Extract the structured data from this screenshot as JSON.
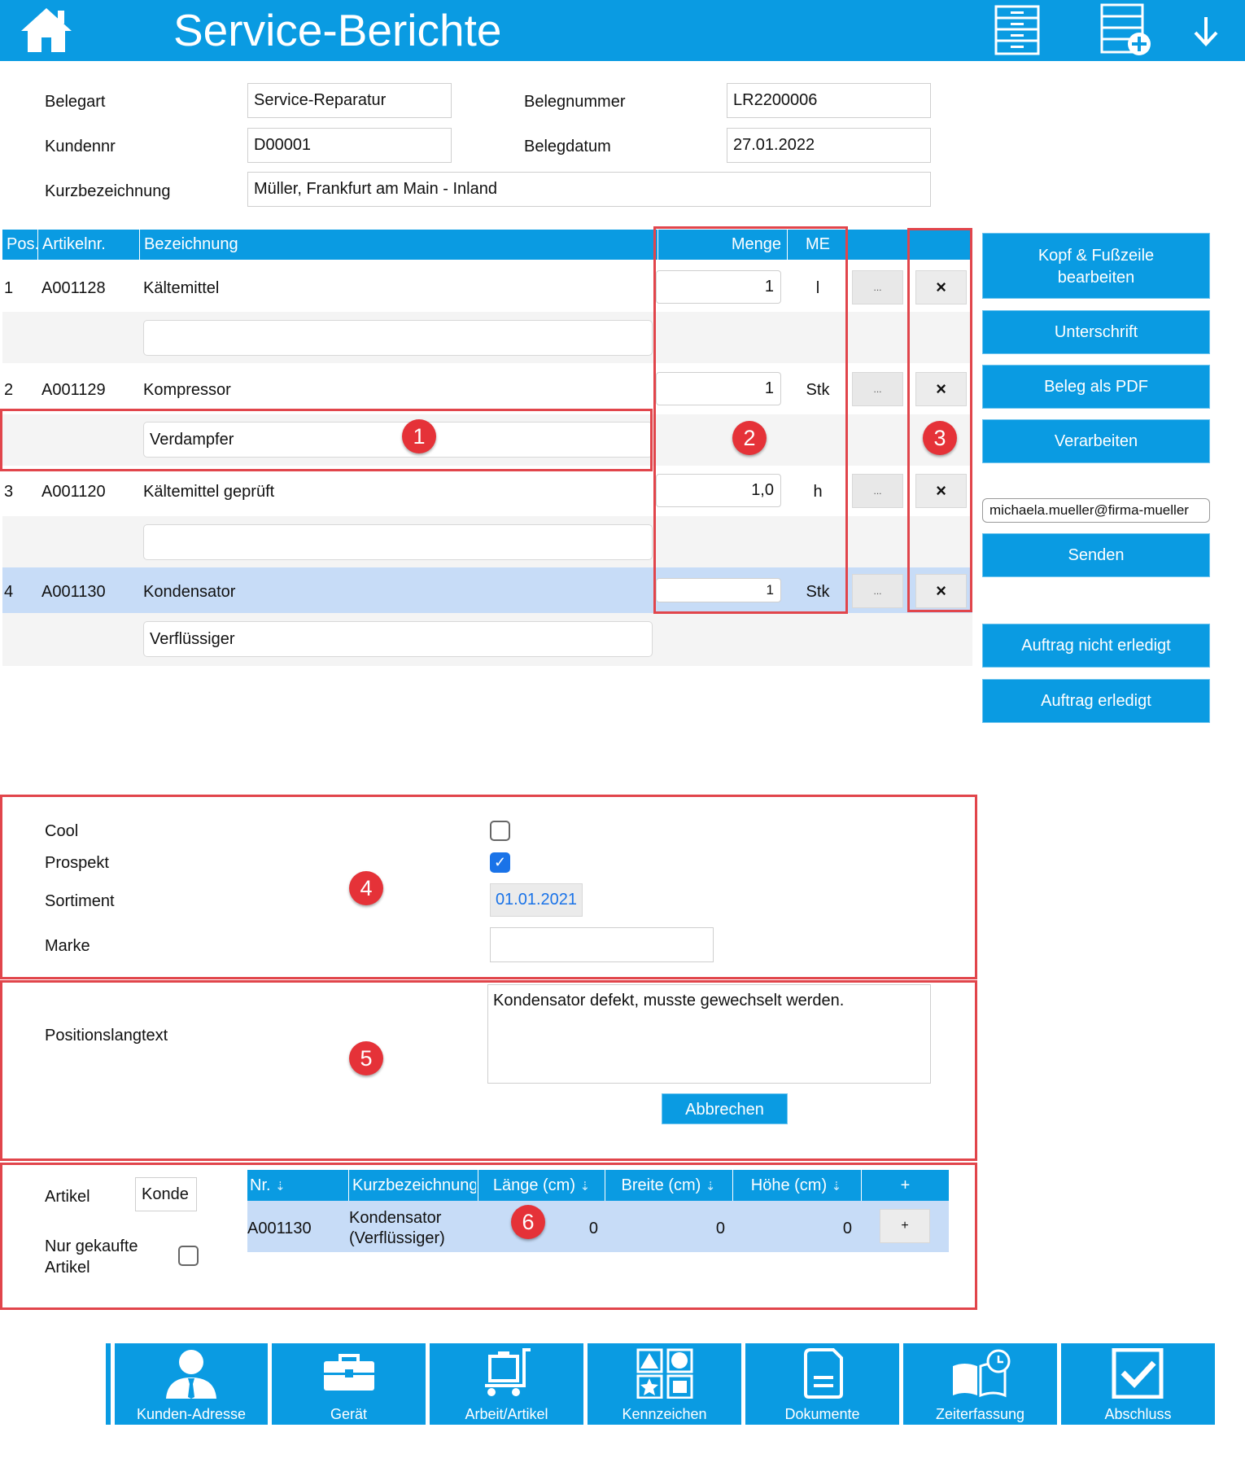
{
  "header": {
    "title": "Service-Berichte",
    "icons": [
      "home-icon",
      "list-icon",
      "list-add-icon",
      "arrow-down-icon"
    ]
  },
  "form": {
    "belegart_label": "Belegart",
    "belegart_value": "Service-Reparatur",
    "belegnummer_label": "Belegnummer",
    "belegnummer_value": "LR2200006",
    "kundennr_label": "Kundennr",
    "kundennr_value": "D00001",
    "belegdatum_label": "Belegdatum",
    "belegdatum_value": "27.01.2022",
    "kurzbezeichnung_label": "Kurzbezeichnung",
    "kurzbezeichnung_value": "Müller, Frankfurt am Main - Inland"
  },
  "positions": {
    "headers": {
      "pos": "Pos.",
      "artikelnr": "Artikelnr.",
      "bezeichnung": "Bezeichnung",
      "menge": "Menge",
      "me": "ME"
    },
    "rows": [
      {
        "pos": "1",
        "artikelnr": "A001128",
        "bezeichnung": "Kältemittel",
        "menge": "1",
        "me": "l",
        "sub": "",
        "more": "...",
        "delete": "×"
      },
      {
        "pos": "2",
        "artikelnr": "A001129",
        "bezeichnung": "Kompressor",
        "menge": "1",
        "me": "Stk",
        "sub": "Verdampfer",
        "more": "...",
        "delete": "×"
      },
      {
        "pos": "3",
        "artikelnr": "A001120",
        "bezeichnung": "Kältemittel geprüft",
        "menge": "1,0",
        "me": "h",
        "sub": "",
        "more": "...",
        "delete": "×"
      },
      {
        "pos": "4",
        "artikelnr": "A001130",
        "bezeichnung": "Kondensator",
        "menge": "1",
        "me": "Stk",
        "sub": "Verflüssiger",
        "more": "...",
        "delete": "×"
      }
    ]
  },
  "sidebar": {
    "kopf_fuss_line1": "Kopf & Fußzeile",
    "kopf_fuss_line2": "bearbeiten",
    "unterschrift": "Unterschrift",
    "beleg_pdf": "Beleg als PDF",
    "verarbeiten": "Verarbeiten",
    "email_value": "michaela.mueller@firma-mueller",
    "senden": "Senden",
    "auftrag_nicht_erledigt": "Auftrag nicht erledigt",
    "auftrag_erledigt": "Auftrag erledigt"
  },
  "badges": [
    "1",
    "2",
    "3",
    "4",
    "5",
    "6"
  ],
  "kennzeichen": {
    "cool_label": "Cool",
    "cool_checked": false,
    "prospekt_label": "Prospekt",
    "prospekt_checked": true,
    "prospekt_check": "✓",
    "sortiment_label": "Sortiment",
    "sortiment_value": "01.01.2021",
    "marke_label": "Marke",
    "marke_value": ""
  },
  "langtext": {
    "label": "Positionslangtext",
    "value": "Kondensator defekt, musste gewechselt werden.",
    "abbrechen": "Abbrechen"
  },
  "artikel_suche": {
    "artikel_label": "Artikel",
    "artikel_value": "Konde",
    "nur_gekauft_line1": "Nur gekaufte",
    "nur_gekauft_line2": "Artikel",
    "nur_gekauft_checked": false,
    "headers": {
      "nr": "Nr.",
      "kurz": "Kurzbezeichnung",
      "laenge": "Länge (cm)",
      "breite": "Breite (cm)",
      "hoehe": "Höhe (cm)",
      "add": "+"
    },
    "sort_icon": "⇣",
    "rows": [
      {
        "nr": "A001130",
        "kurz_line1": "Kondensator",
        "kurz_line2": "(Verflüssiger)",
        "laenge": "0",
        "breite": "0",
        "hoehe": "0",
        "add": "+"
      }
    ]
  },
  "bottom_nav": [
    {
      "label": "Kunden-Adresse",
      "icon": "person-icon"
    },
    {
      "label": "Gerät",
      "icon": "toolbox-icon"
    },
    {
      "label": "Arbeit/Artikel",
      "icon": "cart-icon"
    },
    {
      "label": "Kennzeichen",
      "icon": "shapes-icon"
    },
    {
      "label": "Dokumente",
      "icon": "document-icon"
    },
    {
      "label": "Zeiterfassung",
      "icon": "book-clock-icon"
    },
    {
      "label": "Abschluss",
      "icon": "checkbox-icon"
    }
  ],
  "colors": {
    "accent": "#0a9be2",
    "highlight_row": "#c7dcf7",
    "annotation_red": "#e1454b"
  }
}
